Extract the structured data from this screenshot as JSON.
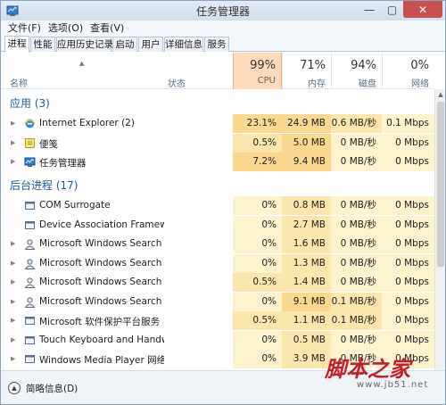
{
  "window": {
    "title": "任务管理器"
  },
  "window_controls": {
    "minimize": "—",
    "maximize": "▢",
    "close": "✕"
  },
  "menu": [
    "文件(F)",
    "选项(O)",
    "查看(V)"
  ],
  "tabs": [
    "进程",
    "性能",
    "应用历史记录",
    "启动",
    "用户",
    "详细信息",
    "服务"
  ],
  "active_tab": "进程",
  "columns": {
    "name": "名称",
    "status": "状态",
    "cpu": {
      "pct": "99%",
      "label": "CPU"
    },
    "memory": {
      "pct": "71%",
      "label": "内存"
    },
    "disk": {
      "pct": "94%",
      "label": "磁盘"
    },
    "network": {
      "pct": "0%",
      "label": "网络"
    }
  },
  "groups": {
    "apps": "应用 (3)",
    "background": "后台进程 (17)"
  },
  "apps": [
    {
      "name": "Internet Explorer (2)",
      "icon": "internet-explorer-icon",
      "cpu": "23.1%",
      "memory": "24.9 MB",
      "disk": "0.6 MB/秒",
      "network": "0.1 Mbps"
    },
    {
      "name": "便笺",
      "icon": "sticky-notes-icon",
      "cpu": "0.5%",
      "memory": "5.0 MB",
      "disk": "0 MB/秒",
      "network": "0 Mbps"
    },
    {
      "name": "任务管理器",
      "icon": "task-manager-icon",
      "cpu": "7.2%",
      "memory": "9.4 MB",
      "disk": "0 MB/秒",
      "network": "0 Mbps"
    }
  ],
  "background": [
    {
      "name": "COM Surrogate",
      "icon": "process-icon",
      "cpu": "0%",
      "memory": "0.8 MB",
      "disk": "0 MB/秒",
      "network": "0 Mbps"
    },
    {
      "name": "Device Association Framewo...",
      "icon": "process-icon",
      "cpu": "0%",
      "memory": "2.7 MB",
      "disk": "0 MB/秒",
      "network": "0 Mbps"
    },
    {
      "name": "Microsoft Windows Search Fi...",
      "icon": "search-user-icon",
      "cpu": "0%",
      "memory": "1.6 MB",
      "disk": "0 MB/秒",
      "network": "0 Mbps"
    },
    {
      "name": "Microsoft Windows Search P...",
      "icon": "search-user-icon",
      "cpu": "0%",
      "memory": "1.3 MB",
      "disk": "0 MB/秒",
      "network": "0 Mbps"
    },
    {
      "name": "Microsoft Windows Search P...",
      "icon": "search-user-icon",
      "cpu": "0.5%",
      "memory": "1.4 MB",
      "disk": "0 MB/秒",
      "network": "0 Mbps"
    },
    {
      "name": "Microsoft Windows Search ...",
      "icon": "search-user-icon",
      "cpu": "0%",
      "memory": "9.1 MB",
      "disk": "0.1 MB/秒",
      "network": "0 Mbps"
    },
    {
      "name": "Microsoft 软件保护平台服务",
      "icon": "process-icon",
      "cpu": "0.5%",
      "memory": "1.1 MB",
      "disk": "0.1 MB/秒",
      "network": "0 Mbps"
    },
    {
      "name": "Touch Keyboard and Handw...",
      "icon": "process-icon",
      "cpu": "0%",
      "memory": "0.5 MB",
      "disk": "0 MB/秒",
      "network": "0 Mbps"
    },
    {
      "name": "Windows Media Player 网络...",
      "icon": "process-icon",
      "cpu": "0%",
      "memory": "3.9 MB",
      "disk": "0 MB/秒",
      "network": "0 Mbps"
    }
  ],
  "footer": {
    "fewer_details": "简略信息(D)"
  },
  "watermark": {
    "main": "脚本之家",
    "url": "www.jb51.net"
  },
  "colors": {
    "cpu_header": "#fcdcbc",
    "cell_high": "#fad890",
    "cell_mid": "#fbe6ad",
    "cell_low": "#fef3cf",
    "group_text": "#1e5aa0"
  }
}
